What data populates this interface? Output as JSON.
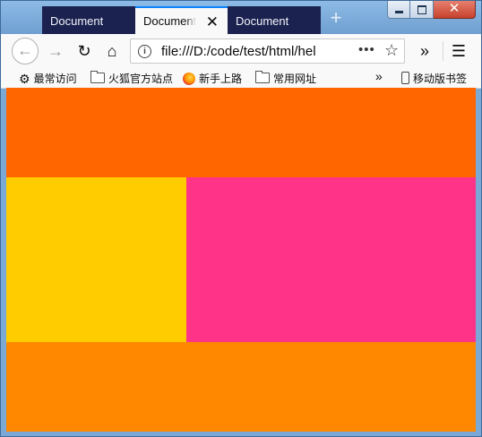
{
  "tabs": [
    {
      "label": "Document",
      "active": false
    },
    {
      "label": "Document",
      "active": true
    },
    {
      "label": "Document",
      "active": false
    }
  ],
  "nav": {
    "url": "file:///D:/code/test/html/hel",
    "page_actions": "•••"
  },
  "bookmarks": {
    "items": [
      {
        "label": "最常访问",
        "icon": "gear-icon"
      },
      {
        "label": "火狐官方站点",
        "icon": "folder-icon"
      },
      {
        "label": "新手上路",
        "icon": "firefox-icon"
      },
      {
        "label": "常用网址",
        "icon": "folder-icon"
      }
    ],
    "overflow": "»",
    "mobile": {
      "label": "移动版书签",
      "icon": "phone-icon"
    }
  },
  "content": {
    "blocks": [
      {
        "name": "top-block",
        "color": "#ff6600"
      },
      {
        "name": "left-block",
        "color": "#ffcc00"
      },
      {
        "name": "right-block",
        "color": "#ff3388"
      },
      {
        "name": "bottom-block",
        "color": "#ff8800"
      }
    ]
  }
}
